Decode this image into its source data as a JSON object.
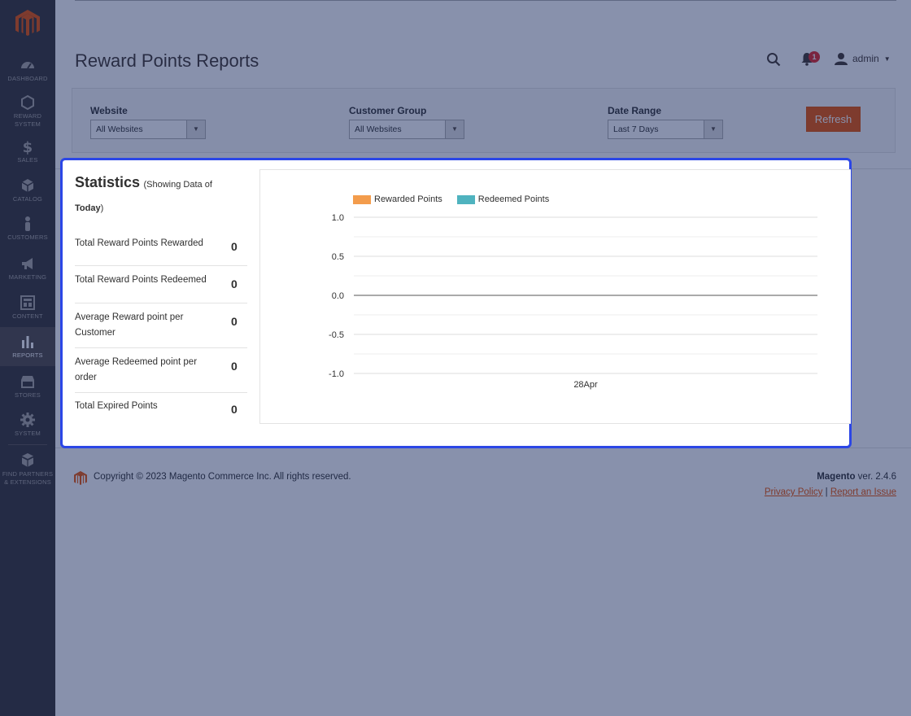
{
  "sidebar": {
    "items": [
      {
        "label": "DASHBOARD",
        "icon": "dashboard-icon"
      },
      {
        "label": "REWARD SYSTEM",
        "icon": "reward-system-icon"
      },
      {
        "label": "SALES",
        "icon": "dollar-icon"
      },
      {
        "label": "CATALOG",
        "icon": "cube-icon"
      },
      {
        "label": "CUSTOMERS",
        "icon": "person-icon"
      },
      {
        "label": "MARKETING",
        "icon": "megaphone-icon"
      },
      {
        "label": "CONTENT",
        "icon": "layout-icon"
      },
      {
        "label": "REPORTS",
        "icon": "bar-chart-icon"
      },
      {
        "label": "STORES",
        "icon": "storefront-icon"
      },
      {
        "label": "SYSTEM",
        "icon": "gear-icon"
      },
      {
        "label": "FIND PARTNERS & EXTENSIONS",
        "icon": "boxes-icon"
      }
    ],
    "active": "REPORTS"
  },
  "header": {
    "title": "Reward Points Reports",
    "notification_count": "1",
    "user": "admin"
  },
  "filters": {
    "website": {
      "label": "Website",
      "value": "All Websites"
    },
    "customer_group": {
      "label": "Customer Group",
      "value": "All Websites"
    },
    "date_range": {
      "label": "Date Range",
      "value": "Last 7 Days"
    },
    "refresh_label": "Refresh"
  },
  "statistics": {
    "title": "Statistics",
    "subtitle_prefix": "(Showing Data of ",
    "subtitle_bold": "Today",
    "subtitle_suffix": ")",
    "rows": [
      {
        "label": "Total Reward Points Rewarded",
        "value": "0"
      },
      {
        "label": "Total Reward Points Redeemed",
        "value": "0"
      },
      {
        "label": "Average Reward point per Customer",
        "value": "0"
      },
      {
        "label": "Average Redeemed point per order",
        "value": "0"
      },
      {
        "label": "Total Expired Points",
        "value": "0"
      }
    ]
  },
  "chart_data": {
    "type": "line",
    "x": [
      "28Apr"
    ],
    "series": [
      {
        "name": "Rewarded Points",
        "values": [
          0
        ],
        "color": "#f39c4c"
      },
      {
        "name": "Redeemed Points",
        "values": [
          0
        ],
        "color": "#4fb3bf"
      }
    ],
    "yticks": [
      "1.0",
      "0.5",
      "0.0",
      "-0.5",
      "-1.0"
    ],
    "ylim": [
      -1,
      1
    ],
    "legend": "top-left",
    "grid": true
  },
  "footer": {
    "copyright": "Copyright © 2023 Magento Commerce Inc. All rights reserved.",
    "brand": "Magento",
    "version": " ver. 2.4.6",
    "privacy": "Privacy Policy",
    "separator": " | ",
    "report": "Report an Issue"
  },
  "colors": {
    "accent": "#eb5202",
    "highlight_border": "#2b46e6",
    "sidebar_bg": "#373330"
  }
}
